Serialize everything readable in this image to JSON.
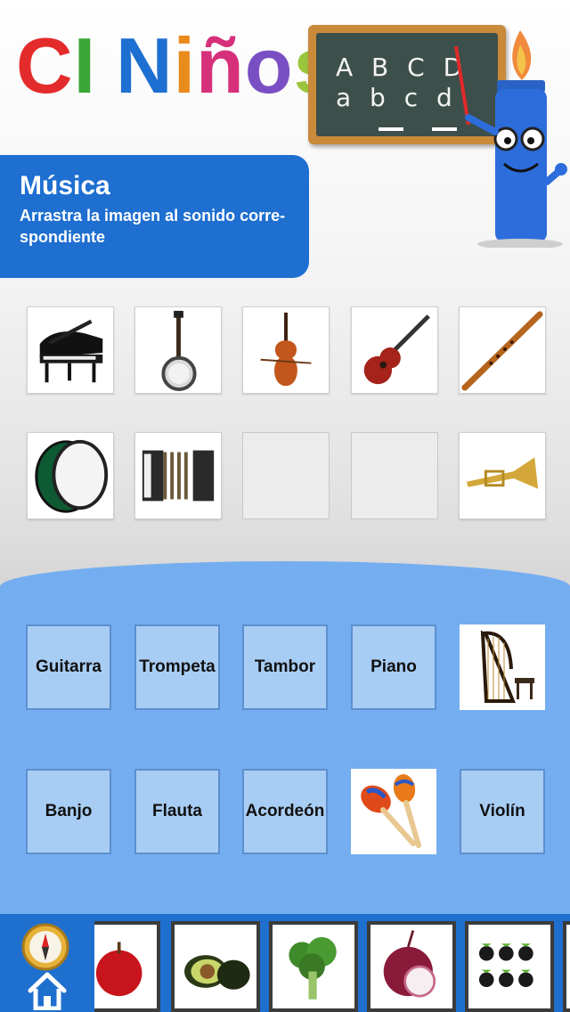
{
  "app": {
    "logo_letters": [
      {
        "ch": "C",
        "color": "#e42b2b"
      },
      {
        "ch": "I",
        "color": "#3aa635"
      },
      {
        "ch": " ",
        "color": "#000000"
      },
      {
        "ch": "N",
        "color": "#1d6fd1"
      },
      {
        "ch": "i",
        "color": "#e98a1c"
      },
      {
        "ch": "ñ",
        "color": "#d6307b"
      },
      {
        "ch": "o",
        "color": "#7a4fc3"
      },
      {
        "ch": "s",
        "color": "#9bc53d"
      }
    ],
    "chalkboard_line1": "A B C D",
    "chalkboard_line2": "a b c d"
  },
  "banner": {
    "title": "Música",
    "subtitle": "Arrastra la imagen al sonido corre-spondiente"
  },
  "image_tiles": [
    {
      "icon": "piano-icon",
      "filled": true
    },
    {
      "icon": "banjo-icon",
      "filled": true
    },
    {
      "icon": "violin-icon",
      "filled": true
    },
    {
      "icon": "guitar-icon",
      "filled": true
    },
    {
      "icon": "flute-icon",
      "filled": true
    },
    {
      "icon": "drum-icon",
      "filled": true
    },
    {
      "icon": "accordion-icon",
      "filled": true
    },
    {
      "icon": "empty-slot",
      "filled": false
    },
    {
      "icon": "empty-slot",
      "filled": false
    },
    {
      "icon": "trumpet-icon",
      "filled": true
    }
  ],
  "answer_cards": [
    {
      "type": "label",
      "text": "Guitarra"
    },
    {
      "type": "label",
      "text": "Trompeta"
    },
    {
      "type": "label",
      "text": "Tambor"
    },
    {
      "type": "label",
      "text": "Piano"
    },
    {
      "type": "image",
      "icon": "harp-icon"
    },
    {
      "type": "label",
      "text": "Banjo"
    },
    {
      "type": "label",
      "text": "Flauta"
    },
    {
      "type": "label",
      "text": "Acordeón"
    },
    {
      "type": "image",
      "icon": "maracas-icon"
    },
    {
      "type": "label",
      "text": "Violín"
    }
  ],
  "bottom_nav": {
    "compass_icon": "compass-icon",
    "home_icon": "home-icon",
    "categories": [
      "apple-icon",
      "avocado-icon",
      "broccoli-icon",
      "onion-icon",
      "blackberries-icon"
    ]
  },
  "colors": {
    "banner": "#1e6fd0",
    "answer_area": "#75aef0",
    "label_card": "#a8cdf4",
    "bottom_bar": "#1f6fce"
  }
}
